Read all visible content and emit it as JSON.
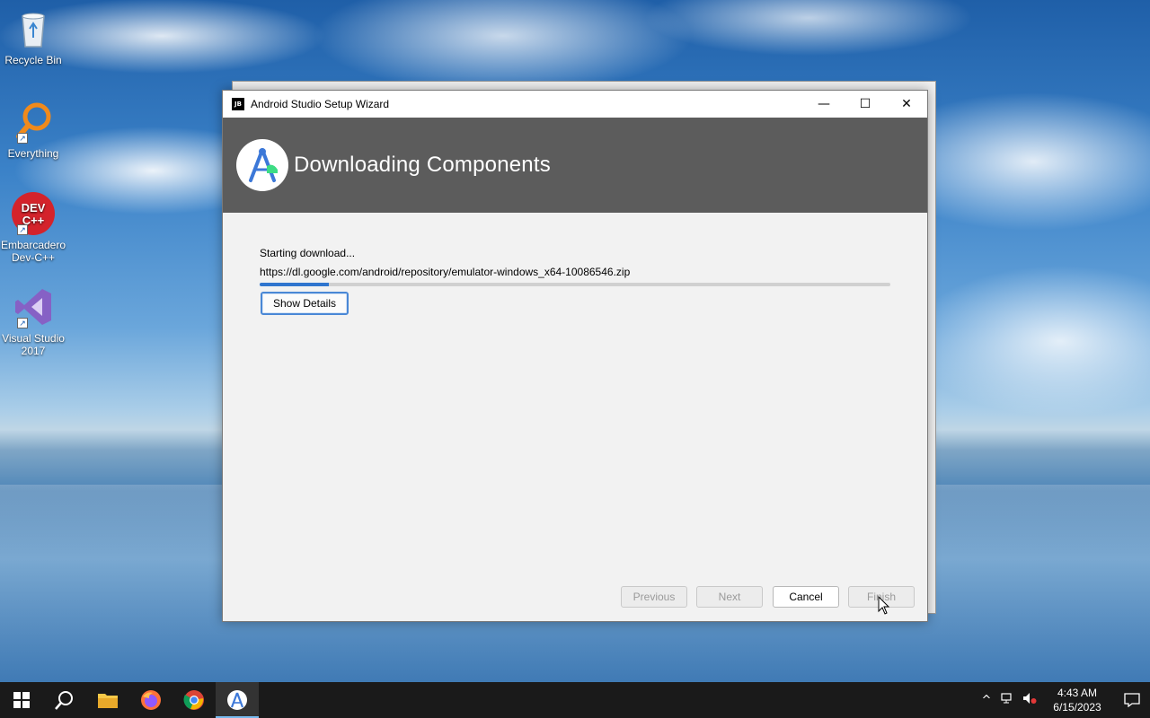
{
  "desktop": {
    "icons": [
      {
        "label": "Recycle Bin"
      },
      {
        "label": "Everything"
      },
      {
        "label": "Embarcadero Dev-C++",
        "logo_text": "DEV C++"
      },
      {
        "label": "Visual Studio 2017"
      }
    ]
  },
  "dialog": {
    "title": "Android Studio Setup Wizard",
    "app_icon_text": "JB",
    "header_title": "Downloading Components",
    "status_text": "Starting download...",
    "url_text": "https://dl.google.com/android/repository/emulator-windows_x64-10086546.zip",
    "progress_fraction": 0.11,
    "show_details_label": "Show Details",
    "buttons": {
      "previous": "Previous",
      "next": "Next",
      "cancel": "Cancel",
      "finish": "Finish"
    },
    "window_controls": {
      "minimize": "—",
      "maximize": "☐",
      "close": "✕"
    }
  },
  "taskbar": {
    "items": [
      "start-icon",
      "search-icon",
      "file-explorer-icon",
      "firefox-icon",
      "chrome-icon",
      "android-studio-icon"
    ],
    "clock_time": "4:43 AM",
    "clock_date": "6/15/2023"
  },
  "colors": {
    "header_bg": "#5c5c5c",
    "progress": "#2f75cf",
    "taskbar": "#1a1a1a"
  }
}
